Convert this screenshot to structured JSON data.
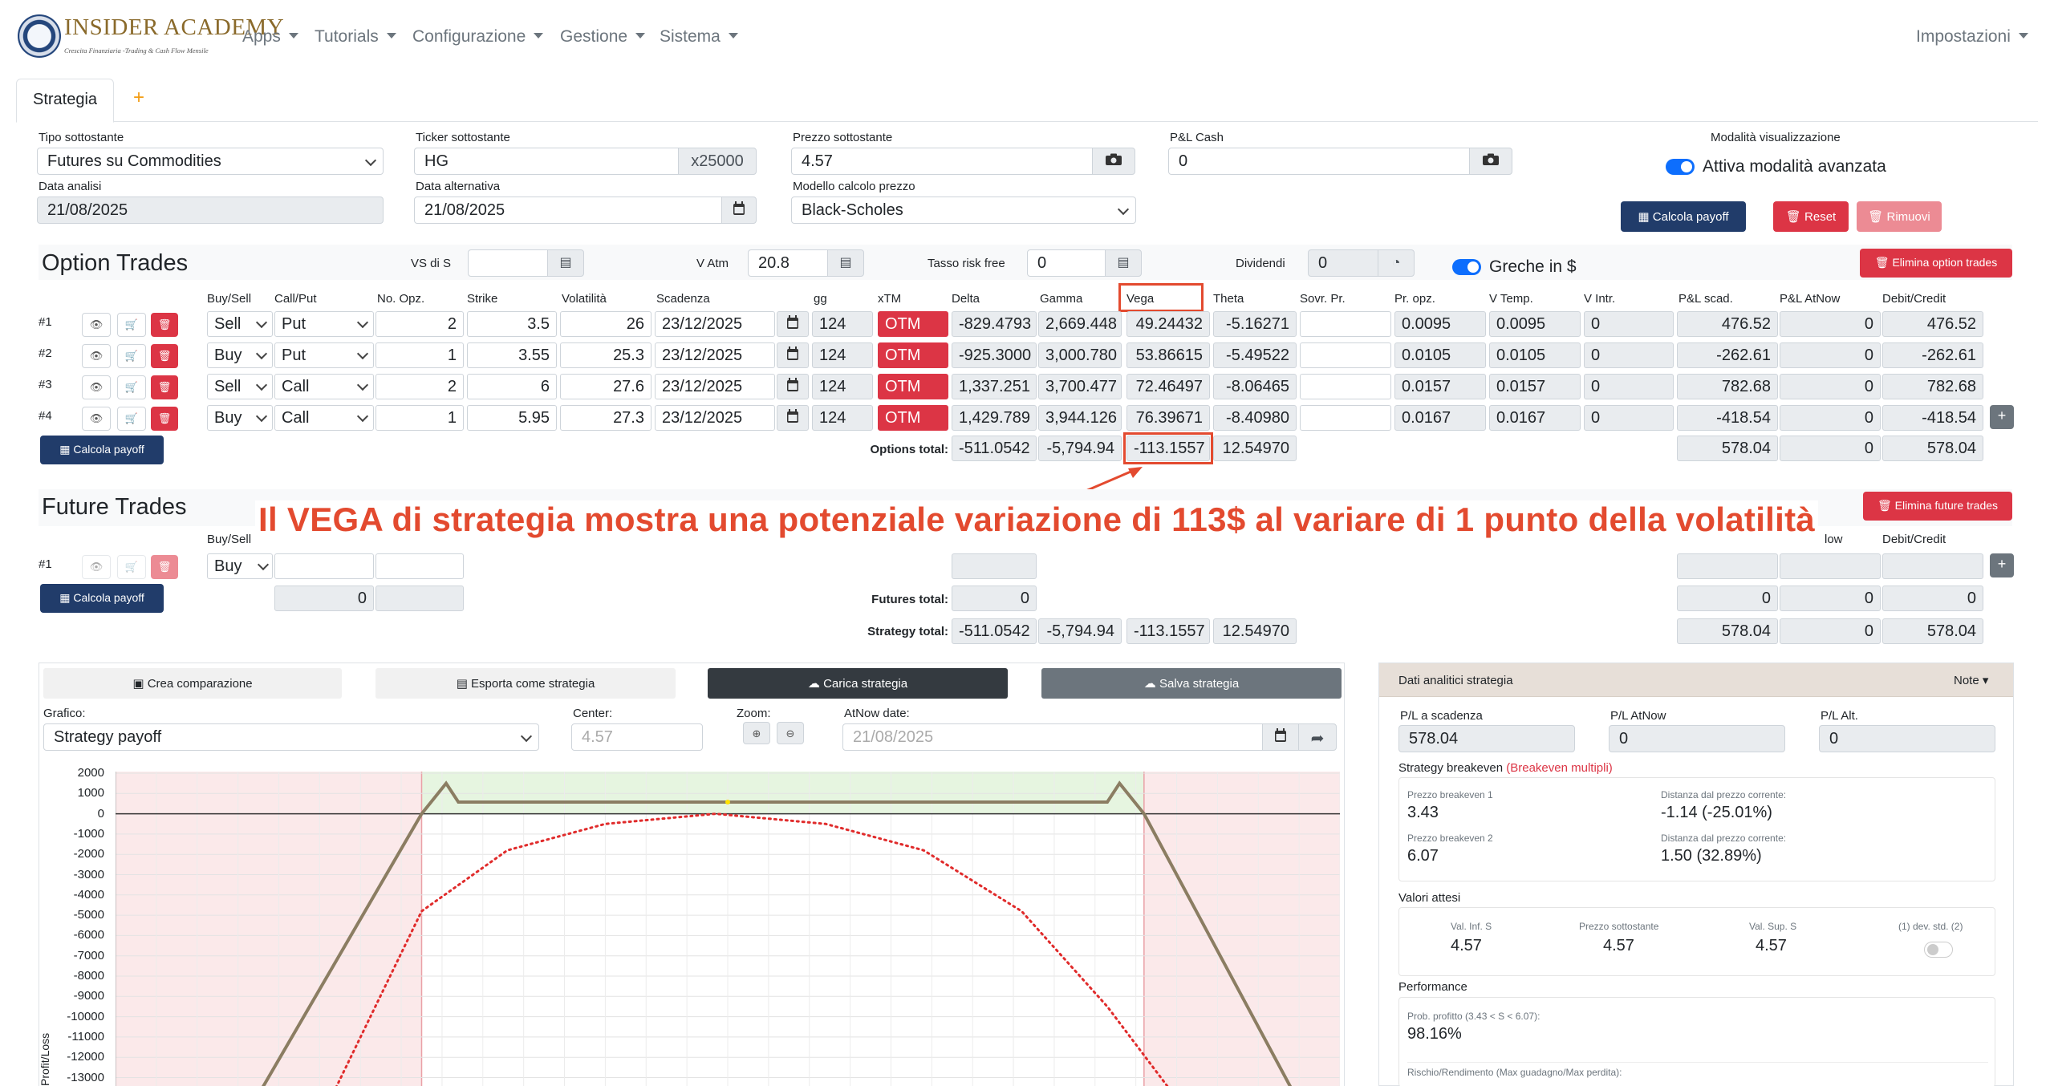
{
  "brand": {
    "title": "INSIDER ACADEMY",
    "subtitle": "Crescita Finanziaria -Trading & Cash Flow Mensile"
  },
  "nav": {
    "items": [
      "Apps",
      "Tutorials",
      "Configurazione",
      "Gestione",
      "Sistema"
    ],
    "settings": "Impostazioni"
  },
  "tabs": {
    "active": "Strategia",
    "add": "+"
  },
  "form": {
    "tipo_label": "Tipo sottostante",
    "tipo_value": "Futures su Commodities",
    "ticker_label": "Ticker sottostante",
    "ticker_value": "HG",
    "ticker_mult": "x25000",
    "prezzo_label": "Prezzo sottostante",
    "prezzo_value": "4.57",
    "pl_cash_label": "P&L Cash",
    "pl_cash_value": "0",
    "mode_label": "Modalità visualizzazione",
    "mode_toggle": "Attiva modalità avanzata",
    "data_analisi_label": "Data analisi",
    "data_analisi_value": "21/08/2025",
    "data_alt_label": "Data alternativa",
    "data_alt_value": "21/08/2025",
    "modello_label": "Modello calcolo prezzo",
    "modello_value": "Black-Scholes",
    "calcola_payoff": "Calcola payoff",
    "reset": "Reset",
    "rimuovi": "Rimuovi"
  },
  "options": {
    "title": "Option Trades",
    "vs_label": "VS di S",
    "vs_value": "",
    "vatm_label": "V Atm",
    "vatm_value": "20.8",
    "risk_label": "Tasso risk free",
    "risk_value": "0",
    "div_label": "Dividendi",
    "div_value": "0",
    "greche_label": "Greche in $",
    "elimina": "Elimina option trades",
    "headers": [
      "Buy/Sell",
      "Call/Put",
      "No. Opz.",
      "Strike",
      "Volatilità",
      "Scadenza",
      "gg",
      "xTM",
      "Delta",
      "Gamma",
      "Vega",
      "Theta",
      "Sovr. Pr.",
      "Pr. opz.",
      "V Temp.",
      "V Intr.",
      "P&L scad.",
      "P&L AtNow",
      "Debit/Credit"
    ],
    "rows": [
      {
        "num": "#1",
        "bs": "Sell",
        "cp": "Put",
        "n": "2",
        "strike": "3.5",
        "vol": "26",
        "scad": "23/12/2025",
        "gg": "124",
        "xtm": "OTM",
        "delta": "-829.4793",
        "gamma": "2,669.448",
        "vega": "49.24432",
        "theta": "-5.16271",
        "sovr": "",
        "propz": "0.0095",
        "vtemp": "0.0095",
        "vintr": "0",
        "pls": "476.52",
        "pla": "0",
        "dc": "476.52"
      },
      {
        "num": "#2",
        "bs": "Buy",
        "cp": "Put",
        "n": "1",
        "strike": "3.55",
        "vol": "25.3",
        "scad": "23/12/2025",
        "gg": "124",
        "xtm": "OTM",
        "delta": "-925.3000",
        "gamma": "3,000.780",
        "vega": "53.86615",
        "theta": "-5.49522",
        "sovr": "",
        "propz": "0.0105",
        "vtemp": "0.0105",
        "vintr": "0",
        "pls": "-262.61",
        "pla": "0",
        "dc": "-262.61"
      },
      {
        "num": "#3",
        "bs": "Sell",
        "cp": "Call",
        "n": "2",
        "strike": "6",
        "vol": "27.6",
        "scad": "23/12/2025",
        "gg": "124",
        "xtm": "OTM",
        "delta": "1,337.251",
        "gamma": "3,700.477",
        "vega": "72.46497",
        "theta": "-8.06465",
        "sovr": "",
        "propz": "0.0157",
        "vtemp": "0.0157",
        "vintr": "0",
        "pls": "782.68",
        "pla": "0",
        "dc": "782.68"
      },
      {
        "num": "#4",
        "bs": "Buy",
        "cp": "Call",
        "n": "1",
        "strike": "5.95",
        "vol": "27.3",
        "scad": "23/12/2025",
        "gg": "124",
        "xtm": "OTM",
        "delta": "1,429.789",
        "gamma": "3,944.126",
        "vega": "76.39671",
        "theta": "-8.40980",
        "sovr": "",
        "propz": "0.0167",
        "vtemp": "0.0167",
        "vintr": "0",
        "pls": "-418.54",
        "pla": "0",
        "dc": "-418.54"
      }
    ],
    "total_label": "Options total:",
    "total": {
      "delta": "-511.0542",
      "gamma": "-5,794.94",
      "vega": "-113.1557",
      "theta": "12.54970",
      "pls": "578.04",
      "pla": "0",
      "dc": "578.04"
    },
    "add": "+"
  },
  "annotation": "Il VEGA di strategia mostra una potenziale variazione di 113$ al variare di 1 punto della volatilità",
  "futures": {
    "title": "Future Trades",
    "elimina": "Elimina future trades",
    "headers": {
      "bs": "Buy/Sell",
      "low": "low",
      "dc": "Debit/Credit"
    },
    "row": {
      "num": "#1",
      "bs": "Buy",
      "qty": "0",
      "pls": "0",
      "pla": "0",
      "dc": "0"
    },
    "total_label": "Futures total:",
    "total": {
      "delta": "0",
      "pls": "0",
      "pla": "0",
      "dc": "0"
    },
    "strat_label": "Strategy total:",
    "strat": {
      "delta": "-511.0542",
      "gamma": "-5,794.94",
      "vega": "-113.1557",
      "theta": "12.54970",
      "pls": "578.04",
      "pla": "0",
      "dc": "578.04"
    },
    "add": "+"
  },
  "chart_controls": {
    "crea": "Crea comparazione",
    "esporta": "Esporta come strategia",
    "carica": "Carica strategia",
    "salva": "Salva strategia",
    "grafico_label": "Grafico:",
    "grafico_value": "Strategy payoff",
    "center_label": "Center:",
    "center_value": "4.57",
    "zoom_label": "Zoom:",
    "atnow_label": "AtNow date:",
    "atnow_value": "21/08/2025",
    "ylabel": "Profit/Loss"
  },
  "chart_data": {
    "type": "line",
    "ylabel": "Profit/Loss",
    "yticks": [
      2000,
      1000,
      0,
      -1000,
      -2000,
      -3000,
      -4000,
      -5000,
      -6000,
      -7000,
      -8000,
      -9000,
      -10000,
      -11000,
      -12000,
      -13000
    ],
    "yticks_labels": [
      "2000",
      "1000",
      "0",
      "-1000",
      "-2000",
      "-3000",
      "-4000",
      "-5000",
      "-6000",
      "-7000",
      "-8000",
      "-9000",
      "-10000",
      "-11000",
      "-12000",
      "-13000"
    ],
    "series": [
      {
        "style": "solid",
        "color": "#8b7d62",
        "points": [
          [
            0.12,
            -13500
          ],
          [
            0.25,
            0
          ],
          [
            0.27,
            1500
          ],
          [
            0.28,
            578
          ],
          [
            0.81,
            578
          ],
          [
            0.82,
            1500
          ],
          [
            0.84,
            0
          ],
          [
            0.96,
            -13500
          ]
        ]
      },
      {
        "style": "dotted",
        "color": "#e02b2b",
        "points": [
          [
            0.18,
            -13500
          ],
          [
            0.25,
            -4800
          ],
          [
            0.32,
            -1800
          ],
          [
            0.4,
            -500
          ],
          [
            0.49,
            0
          ],
          [
            0.58,
            -500
          ],
          [
            0.66,
            -1800
          ],
          [
            0.74,
            -4800
          ],
          [
            0.81,
            -9500
          ],
          [
            0.86,
            -13500
          ]
        ]
      }
    ],
    "profit_zone": [
      0.25,
      0.84
    ],
    "current_price_x": 0.5
  },
  "panel": {
    "title": "Dati analitici strategia",
    "note": "Note",
    "pl_scad_label": "P/L a scadenza",
    "pl_scad": "578.04",
    "pl_atnow_label": "P/L AtNow",
    "pl_atnow": "0",
    "pl_alt_label": "P/L Alt.",
    "pl_alt": "0",
    "be_title": "Strategy breakeven",
    "be_multi": "(Breakeven multipli)",
    "be1_label": "Prezzo breakeven 1",
    "be1": "3.43",
    "d1_label": "Distanza dal prezzo corrente:",
    "d1": "-1.14 (-25.01%)",
    "be2_label": "Prezzo breakeven 2",
    "be2": "6.07",
    "d2_label": "Distanza dal prezzo corrente:",
    "d2": "1.50 (32.89%)",
    "va_title": "Valori attesi",
    "va_inf_label": "Val. Inf. S",
    "va_inf": "4.57",
    "va_prz_label": "Prezzo sottostante",
    "va_prz": "4.57",
    "va_sup_label": "Val. Sup. S",
    "va_sup": "4.57",
    "va_dev_label": "(1) dev. std. (2)",
    "perf_title": "Performance",
    "prob_label": "Prob. profitto (3.43 < S < 6.07):",
    "prob": "98.16%",
    "rr_label": "Rischio/Rendimento (Max guadagno/Max perdita):"
  }
}
